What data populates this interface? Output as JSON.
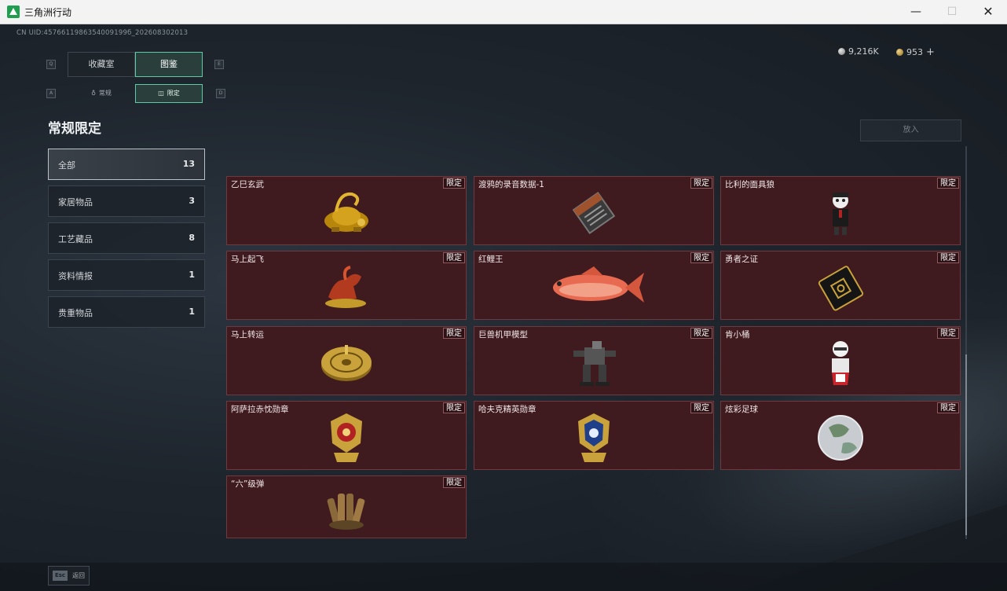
{
  "window": {
    "title": "三角洲行动",
    "min_symbol": "—",
    "max_symbol": "☐",
    "close_symbol": "✕"
  },
  "uid_text": "CN UID:4576611986354009199б_202608302013",
  "currency": {
    "silver": "9,216K",
    "gold": "953",
    "add": "+"
  },
  "key_hints": {
    "left_main": "Q",
    "right_main": "E",
    "left_sub": "A",
    "right_sub": "D"
  },
  "main_tabs": [
    {
      "label": "收藏室"
    },
    {
      "label": "图鉴"
    }
  ],
  "sub_tabs": [
    {
      "label": "常规",
      "icon": "♁"
    },
    {
      "label": "限定",
      "icon": "◫"
    }
  ],
  "page_title": "常规限定",
  "filters": [
    {
      "label": "全部",
      "count": "13"
    },
    {
      "label": "家居物品",
      "count": "3"
    },
    {
      "label": "工艺藏品",
      "count": "8"
    },
    {
      "label": "资料情报",
      "count": "1"
    },
    {
      "label": "贵重物品",
      "count": "1"
    }
  ],
  "action_button": "放入",
  "items": [
    {
      "name": "乙巳玄武",
      "badge": "限定",
      "icon": "gold-tortoise-icon"
    },
    {
      "name": "渡鸦的录音数据-1",
      "badge": "限定",
      "icon": "recorder-icon"
    },
    {
      "name": "比利的面具狼",
      "badge": "限定",
      "icon": "puppet-figure-icon"
    },
    {
      "name": "马上起飞",
      "badge": "限定",
      "icon": "horse-statue-icon"
    },
    {
      "name": "红鲤王",
      "badge": "限定",
      "icon": "red-carp-icon"
    },
    {
      "name": "勇者之证",
      "badge": "限定",
      "icon": "black-card-icon"
    },
    {
      "name": "马上转运",
      "badge": "限定",
      "icon": "gold-disc-icon"
    },
    {
      "name": "巨兽机甲模型",
      "badge": "限定",
      "icon": "mech-model-icon"
    },
    {
      "name": "肯小桶",
      "badge": "限定",
      "icon": "bucket-figure-icon"
    },
    {
      "name": "阿萨拉赤忱勋章",
      "badge": "限定",
      "icon": "red-medal-icon"
    },
    {
      "name": "哈夫克精英勋章",
      "badge": "限定",
      "icon": "blue-medal-icon"
    },
    {
      "name": "炫彩足球",
      "badge": "限定",
      "icon": "football-icon"
    },
    {
      "name": "“六”级弹",
      "badge": "限定",
      "icon": "shell-cluster-icon"
    }
  ],
  "esc": {
    "key": "Esc",
    "label": "返回"
  },
  "colors": {
    "accent": "#5fc9a8",
    "card_bg": "#3f1b1f",
    "card_border": "#6e3a40"
  }
}
